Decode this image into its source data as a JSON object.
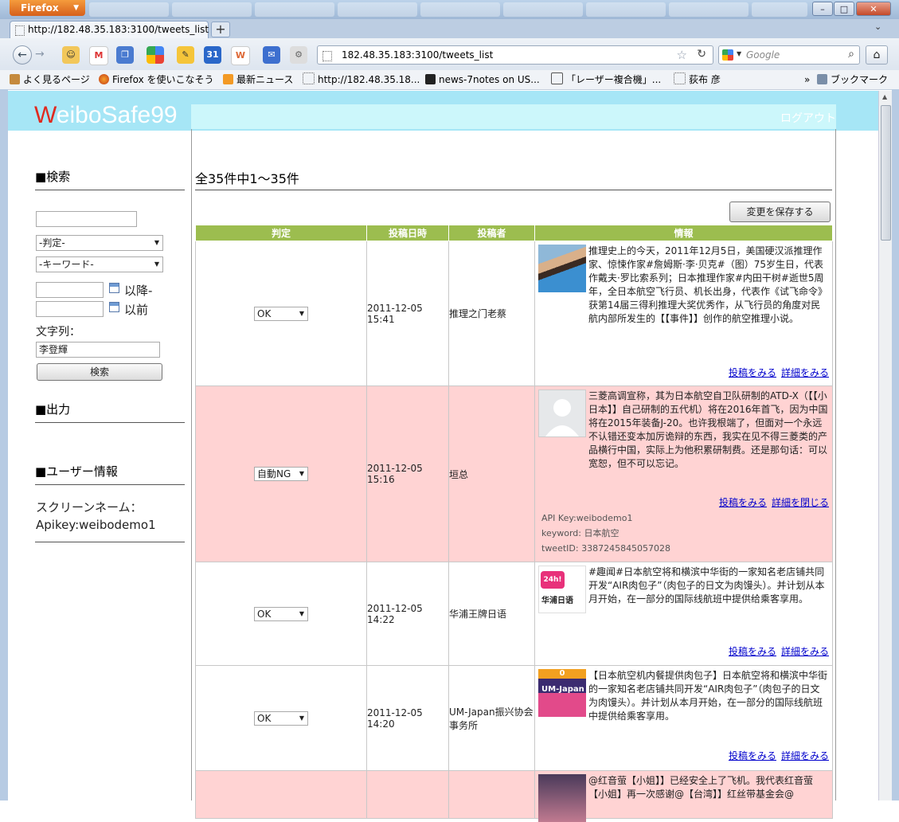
{
  "browser": {
    "app_button": "Firefox",
    "tab_title": "http://182.48.35.183:3100/tweets_list",
    "url": "182.48.35.183:3100/tweets_list",
    "search_placeholder": "Google",
    "bookmarks": [
      "よく見るページ",
      "Firefox を使いこなそう",
      "最新ニュース",
      "http://182.48.35.18...",
      "news-7notes on US...",
      "「レーザー複合機」...",
      "荻布 彦",
      "ブックマーク"
    ],
    "bookmarks_overflow": "»"
  },
  "header": {
    "brand_first": "W",
    "brand_rest": "eiboSafe99",
    "logout": "ログアウト"
  },
  "sidebar": {
    "search_title": "■検索",
    "judge_select": "-判定-",
    "keyword_select": "-キーワード-",
    "after_label": "以降-",
    "before_label": "以前",
    "string_label": "文字列：",
    "string_value": "李登輝",
    "search_button": "検索",
    "output_title": "■出力",
    "user_title": "■ユーザー情報",
    "screen_name": "スクリーンネーム：",
    "apikey": "Apikey:weibodemo1"
  },
  "main": {
    "count_text": "全35件中1～35件",
    "save_button": "変更を保存する",
    "columns": [
      "判定",
      "投稿日時",
      "投稿者",
      "情報"
    ],
    "rows": [
      {
        "judgement": "OK",
        "date": "2011-12-05 15:41",
        "author": "推理之门老蔡",
        "text": "推理史上的今天，2011年12月5日，美国硬汉派推理作家、惊悚作家#詹姆斯·李·贝克#（图）75岁生日，代表作戴夫·罗比索系列；日本推理作家#内田干树#逝世5周年，全日本航空飞行员、机长出身，代表作《试飞命令》获第14届三得利推理大奖优秀作，从飞行员的角度对民航内部所发生的【【事件】】创作的航空推理小说。",
        "link_post": "投稿をみる",
        "link_detail": "詳細をみる",
        "state": "ok"
      },
      {
        "judgement": "自動NG",
        "date": "2011-12-05 15:16",
        "author": "垣总",
        "text": "三菱高调宣称，其为日本航空自卫队研制的ATD-X（【【小日本】】自己研制的五代机）将在2016年首飞，因为中国将在2015年装备J-20。也许我根端了，但面对一个永远不认错还变本加厉诡辩的东西，我实在见不得三菱类的产品横行中国，实际上为他积累研制费。还是那句话：可以宽恕，但不可以忘记。",
        "link_post": "投稿をみる",
        "link_detail": "詳細を閉じる",
        "api_key": "API Key:weibodemo1",
        "keyword": "keyword: 日本航空",
        "tweet_id": "tweetID: 3387245845057028",
        "state": "ng"
      },
      {
        "judgement": "OK",
        "date": "2011-12-05 14:22",
        "author": "华浦王牌日语",
        "text": "#趣闻#日本航空将和横滨中华街的一家知名老店铺共同开发“AIR肉包子”（肉包子的日文为肉馒头）。并计划从本月开始，在一部分的国际线航班中提供给乘客享用。",
        "link_post": "投稿をみる",
        "link_detail": "詳細をみる",
        "state": "ok"
      },
      {
        "judgement": "OK",
        "date": "2011-12-05 14:20",
        "author": "UM-Japan振兴协会事务所",
        "text": "【日本航空机内餐提供肉包子】日本航空将和横滨中华街的一家知名老店铺共同开发“AIR肉包子”（肉包子的日文为肉馒头）。并计划从本月开始，在一部分的国际线航班中提供给乘客享用。",
        "link_post": "投稿をみる",
        "link_detail": "詳細をみる",
        "state": "ok"
      },
      {
        "text": "@红音萤【小姐】】已经安全上了飞机。我代表红音萤【小姐】再一次感谢@【台湾】】红丝带基金会@",
        "state": "ng"
      }
    ],
    "avatar_badges": {
      "r3_badge": "24h!",
      "r3_caption": "华浦日语",
      "r4_badge": "0",
      "r4_caption": "UM-Japan"
    }
  },
  "colors": {
    "header_band": "#a6e6f6",
    "table_header": "#9cbd4f",
    "ng_row": "#ffd3d3",
    "brand_w": "#e0291e"
  }
}
